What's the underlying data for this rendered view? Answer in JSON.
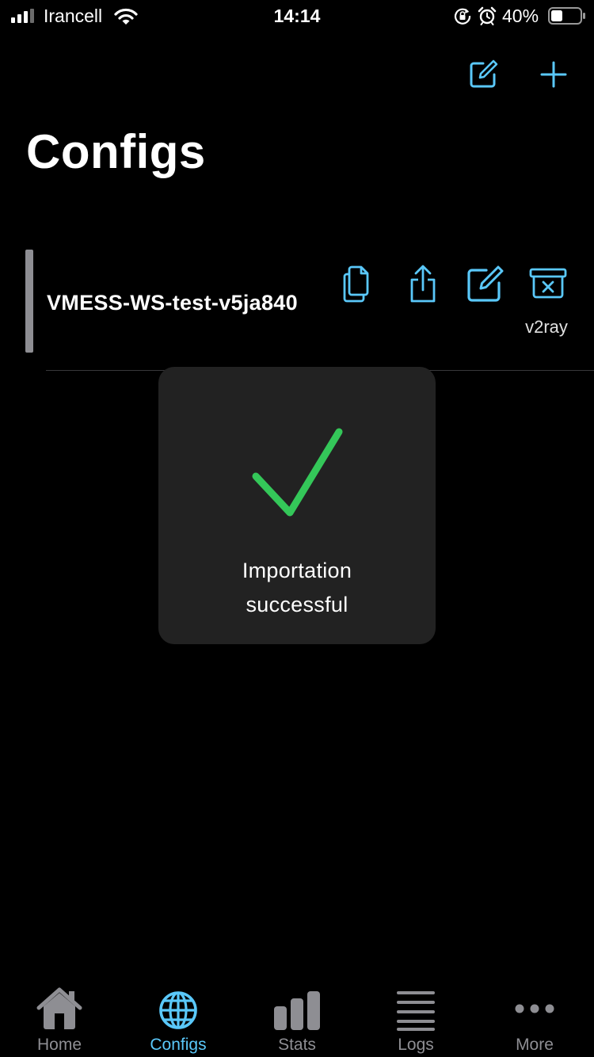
{
  "status_bar": {
    "carrier": "Irancell",
    "time": "14:14",
    "battery_percent": "40%",
    "battery_level": 0.4,
    "icons": [
      "signal-icon",
      "wifi-icon",
      "orientation-lock-icon",
      "alarm-icon",
      "battery-icon"
    ]
  },
  "nav": {
    "title": "Configs",
    "actions": [
      "edit-icon",
      "plus-icon"
    ]
  },
  "configs": [
    {
      "name": "VMESS-WS-test-v5ja840",
      "type": "v2ray",
      "actions": [
        "copy-icon",
        "share-icon",
        "edit-icon",
        "delete-icon"
      ]
    }
  ],
  "toast": {
    "line1": "Importation",
    "line2": "successful",
    "icon": "checkmark-icon"
  },
  "tabs": [
    {
      "label": "Home",
      "icon": "house-icon",
      "active": false
    },
    {
      "label": "Configs",
      "icon": "globe-icon",
      "active": true
    },
    {
      "label": "Stats",
      "icon": "bar-chart-icon",
      "active": false
    },
    {
      "label": "Logs",
      "icon": "list-lines-icon",
      "active": false
    },
    {
      "label": "More",
      "icon": "ellipsis-icon",
      "active": false
    }
  ],
  "colors": {
    "background": "#000000",
    "accent": "#5ac8fa",
    "inactive": "#8e8e93",
    "success": "#34c759",
    "toast_bg": "#222222"
  }
}
